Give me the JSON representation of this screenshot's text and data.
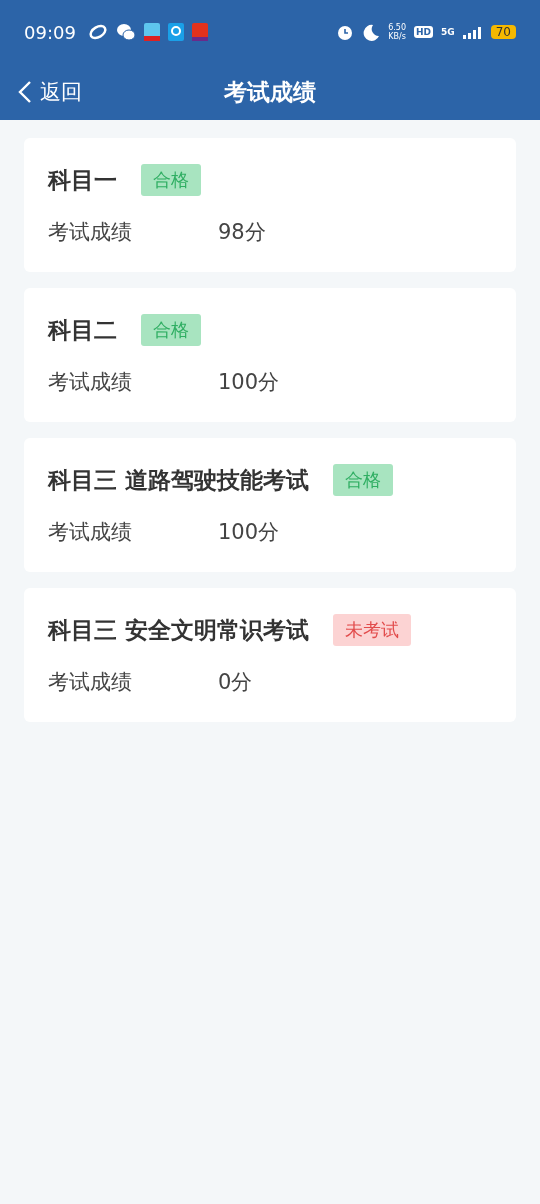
{
  "status_bar": {
    "time": "09:09",
    "speed": "6.50",
    "speed_unit": "KB/s",
    "hd": "HD",
    "network": "5G",
    "battery": "70"
  },
  "header": {
    "back": "返回",
    "title": "考试成绩"
  },
  "subjects": [
    {
      "name": "科目一",
      "status": "合格",
      "kind": "passed",
      "label": "考试成绩",
      "score": "98分"
    },
    {
      "name": "科目二",
      "status": "合格",
      "kind": "passed",
      "label": "考试成绩",
      "score": "100分"
    },
    {
      "name": "科目三 道路驾驶技能考试",
      "status": "合格",
      "kind": "passed",
      "label": "考试成绩",
      "score": "100分"
    },
    {
      "name": "科目三 安全文明常识考试",
      "status": "未考试",
      "kind": "not_taken",
      "label": "考试成绩",
      "score": "0分"
    }
  ]
}
